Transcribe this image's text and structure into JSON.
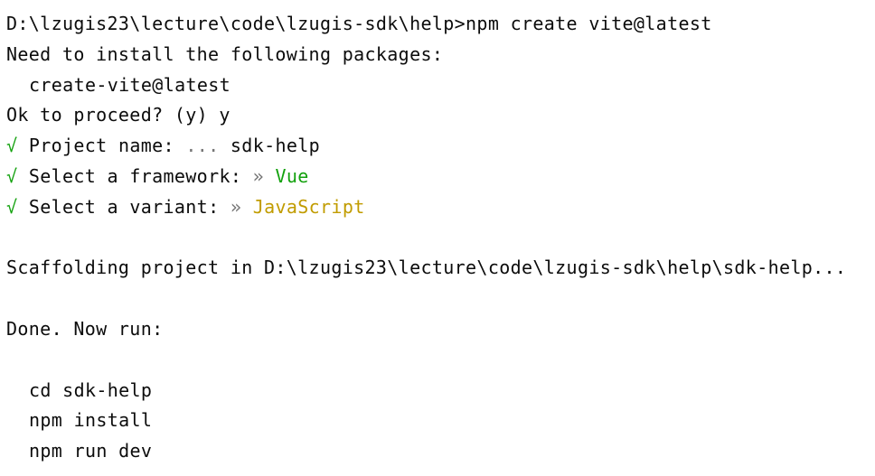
{
  "terminal": {
    "command_line": "D:\\lzugis23\\lecture\\code\\lzugis-sdk\\help>npm create vite@latest",
    "need_install": "Need to install the following packages:",
    "package": "create-vite@latest",
    "proceed": "Ok to proceed? (y) y",
    "check_mark": "√",
    "project_name_label": "Project name:",
    "project_name_dots": "...",
    "project_name_value": "sdk-help",
    "framework_label": "Select a framework:",
    "framework_arrow": "»",
    "framework_value": "Vue",
    "variant_label": "Select a variant:",
    "variant_arrow": "»",
    "variant_value": "JavaScript",
    "scaffolding": "Scaffolding project in D:\\lzugis23\\lecture\\code\\lzugis-sdk\\help\\sdk-help...",
    "done": "Done. Now run:",
    "cmd1": "cd sdk-help",
    "cmd2": "npm install",
    "cmd3": "npm run dev"
  },
  "colors": {
    "background": "#ffffff",
    "text": "#0c0c0c",
    "success_green": "#13a10e",
    "muted_gray": "#767676",
    "javascript_yellow": "#c19c00"
  }
}
